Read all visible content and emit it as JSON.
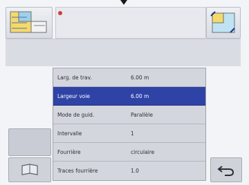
{
  "rows": [
    {
      "label": "Larg. de trav.",
      "value": "6.00 m",
      "selected": false
    },
    {
      "label": "Largeur voie",
      "value": "6.00 m",
      "selected": true
    },
    {
      "label": "Mode de guid.",
      "value": "Parallèle",
      "selected": false
    },
    {
      "label": "Intervalle",
      "value": "1",
      "selected": false
    },
    {
      "label": "Fourrière",
      "value": "circulaire",
      "selected": false
    },
    {
      "label": "Traces fourrière",
      "value": "1.0",
      "selected": false
    }
  ],
  "colors": {
    "selected_row": "#2f43a6",
    "indicator": "#d23b3b"
  }
}
